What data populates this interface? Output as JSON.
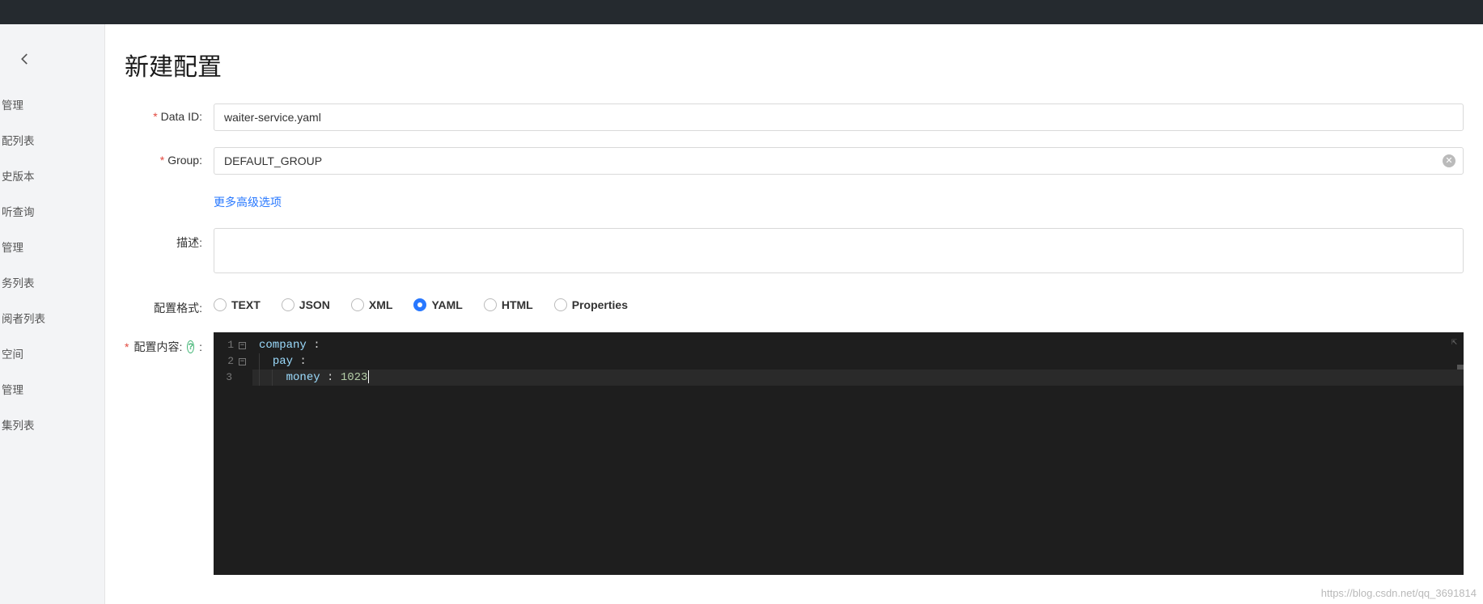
{
  "header": {},
  "sidebar": {
    "items": [
      {
        "label": "管理"
      },
      {
        "label": "配列表"
      },
      {
        "label": "史版本"
      },
      {
        "label": "听查询"
      },
      {
        "label": "管理"
      },
      {
        "label": "务列表"
      },
      {
        "label": "阅者列表"
      },
      {
        "label": "空间"
      },
      {
        "label": "管理"
      },
      {
        "label": "集列表"
      }
    ]
  },
  "page": {
    "title": "新建配置"
  },
  "form": {
    "data_id": {
      "label": "Data ID:",
      "value": "waiter-service.yaml"
    },
    "group": {
      "label": "Group:",
      "value": "DEFAULT_GROUP"
    },
    "advanced_link": "更多高级选项",
    "description": {
      "label": "描述:",
      "value": ""
    },
    "format": {
      "label": "配置格式:",
      "options": [
        "TEXT",
        "JSON",
        "XML",
        "YAML",
        "HTML",
        "Properties"
      ],
      "selected": "YAML"
    },
    "content": {
      "label": "配置内容:",
      "help": "?",
      "lines": [
        {
          "n": "1",
          "fold": true,
          "indent": 0,
          "key": "company",
          "after": " :"
        },
        {
          "n": "2",
          "fold": true,
          "indent": 1,
          "key": "pay",
          "after": " :"
        },
        {
          "n": "3",
          "fold": false,
          "indent": 2,
          "key": "money",
          "after": " : ",
          "value": "1023",
          "active": true
        }
      ]
    }
  },
  "watermark": "https://blog.csdn.net/qq_3691814"
}
